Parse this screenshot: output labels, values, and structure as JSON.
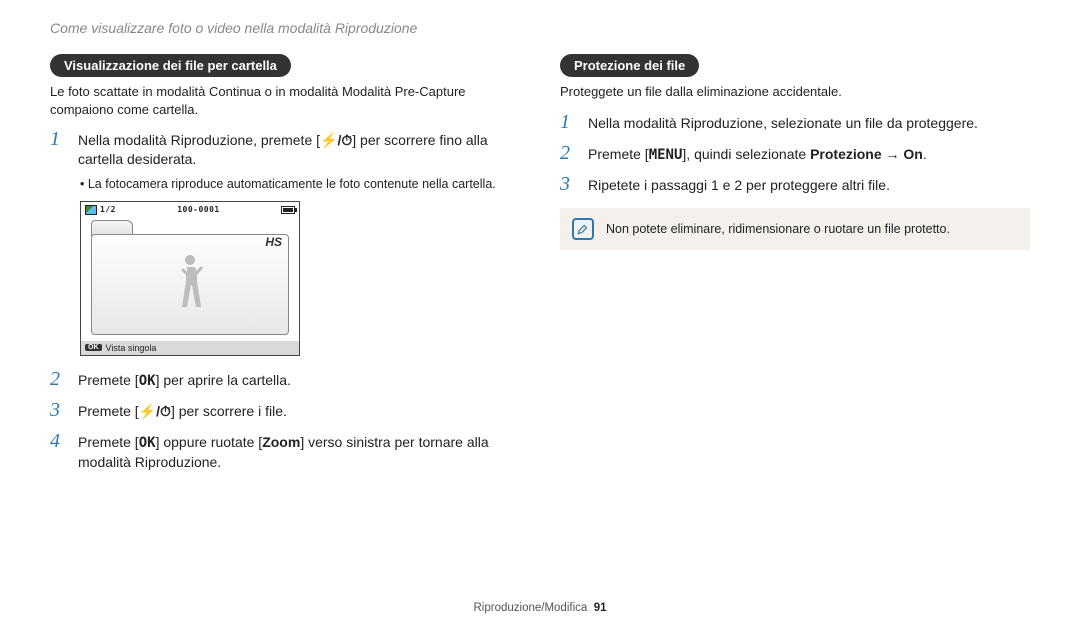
{
  "header": {
    "breadcrumb": "Come visualizzare foto o video nella modalità Riproduzione"
  },
  "left": {
    "pill": "Visualizzazione dei file per cartella",
    "intro": "Le foto scattate in modalità Continua o in modalità Modalità Pre-Capture compaiono come cartella.",
    "step1_pre": "Nella modalità Riproduzione, premete [",
    "step1_glyph": "⚡/⏱",
    "step1_post": "] per scorrere fino alla cartella desiderata.",
    "bullet": "La fotocamera riproduce automaticamente le foto contenute nella cartella.",
    "lcd": {
      "counter": "1/2",
      "file_id": "100-0001",
      "hs_label": "HS",
      "bottom_label": "Vista singola",
      "ok_label": "OK"
    },
    "step2_pre": "Premete [",
    "step2_btn": "OK",
    "step2_post": "] per aprire la cartella.",
    "step3_pre": "Premete [",
    "step3_glyph": "⚡/⏱",
    "step3_post": "] per scorrere i file.",
    "step4_pre": "Premete [",
    "step4_btn": "OK",
    "step4_mid": "] oppure ruotate [",
    "step4_zoom": "Zoom",
    "step4_post": "] verso sinistra per tornare alla modalità Riproduzione."
  },
  "right": {
    "pill": "Protezione dei file",
    "intro": "Proteggete un file dalla eliminazione accidentale.",
    "step1": "Nella modalità Riproduzione, selezionate un file da proteggere.",
    "step2_pre": "Premete [",
    "step2_btn": "MENU",
    "step2_mid": "], quindi selezionate ",
    "step2_opt1": "Protezione",
    "step2_arrow": " → ",
    "step2_opt2": "On",
    "step2_post": ".",
    "step3": "Ripetete i passaggi 1 e 2 per proteggere altri file.",
    "note": "Non potete eliminare, ridimensionare o ruotare un file protetto."
  },
  "footer": {
    "section": "Riproduzione/Modifica",
    "page": "91"
  },
  "nums": {
    "n1": "1",
    "n2": "2",
    "n3": "3",
    "n4": "4"
  }
}
